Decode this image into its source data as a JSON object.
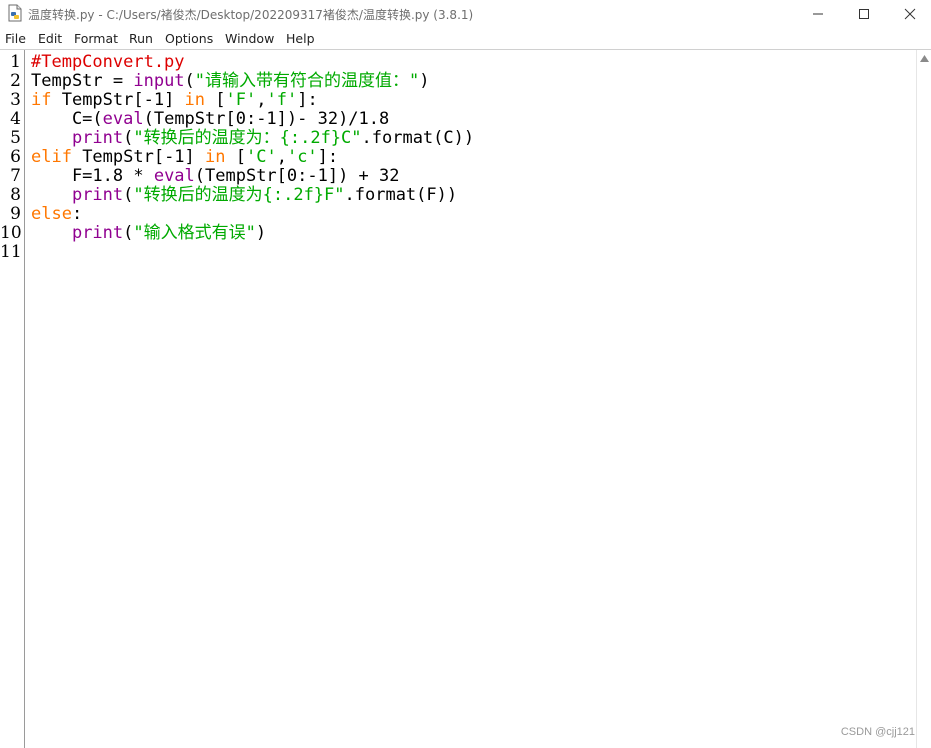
{
  "window": {
    "title_prefix": "温度转换.py - ",
    "title_path": "C:/Users/褚俊杰/Desktop/202209317褚俊杰/温度转换.py",
    "title_version": " (3.8.1)",
    "controls": [
      "minimize-icon",
      "maximize-icon",
      "close-icon"
    ]
  },
  "menu": [
    "File",
    "Edit",
    "Format",
    "Run",
    "Options",
    "Window",
    "Help"
  ],
  "colors": {
    "comment": "#dd0000",
    "keyword": "#ff7700",
    "builtin": "#900090",
    "string": "#00aa00",
    "default": "#000000"
  },
  "line_numbers": [
    "1",
    "2",
    "3",
    "4",
    "5",
    "6",
    "7",
    "8",
    "9",
    "10",
    "11"
  ],
  "code": [
    [
      {
        "t": "#TempConvert.py",
        "c": "comment"
      }
    ],
    [
      {
        "t": "TempStr = ",
        "c": "default"
      },
      {
        "t": "input",
        "c": "builtin"
      },
      {
        "t": "(",
        "c": "default"
      },
      {
        "t": "\"请输入带有符合的温度值：\"",
        "c": "string"
      },
      {
        "t": ")",
        "c": "default"
      }
    ],
    [
      {
        "t": "if",
        "c": "keyword"
      },
      {
        "t": " TempStr[-1] ",
        "c": "default"
      },
      {
        "t": "in",
        "c": "keyword"
      },
      {
        "t": " [",
        "c": "default"
      },
      {
        "t": "'F'",
        "c": "string"
      },
      {
        "t": ",",
        "c": "default"
      },
      {
        "t": "'f'",
        "c": "string"
      },
      {
        "t": "]:",
        "c": "default"
      }
    ],
    [
      {
        "t": "    C=(",
        "c": "default"
      },
      {
        "t": "eval",
        "c": "builtin"
      },
      {
        "t": "(TempStr[0:-1])- 32)/1.8",
        "c": "default"
      }
    ],
    [
      {
        "t": "    ",
        "c": "default"
      },
      {
        "t": "print",
        "c": "builtin"
      },
      {
        "t": "(",
        "c": "default"
      },
      {
        "t": "\"转换后的温度为：{:.2f}C\"",
        "c": "string"
      },
      {
        "t": ".format(C))",
        "c": "default"
      }
    ],
    [
      {
        "t": "elif",
        "c": "keyword"
      },
      {
        "t": " TempStr[-1] ",
        "c": "default"
      },
      {
        "t": "in",
        "c": "keyword"
      },
      {
        "t": " [",
        "c": "default"
      },
      {
        "t": "'C'",
        "c": "string"
      },
      {
        "t": ",",
        "c": "default"
      },
      {
        "t": "'c'",
        "c": "string"
      },
      {
        "t": "]:",
        "c": "default"
      }
    ],
    [
      {
        "t": "    F=1.8 * ",
        "c": "default"
      },
      {
        "t": "eval",
        "c": "builtin"
      },
      {
        "t": "(TempStr[0:-1]) + 32",
        "c": "default"
      }
    ],
    [
      {
        "t": "    ",
        "c": "default"
      },
      {
        "t": "print",
        "c": "builtin"
      },
      {
        "t": "(",
        "c": "default"
      },
      {
        "t": "\"转换后的温度为{:.2f}F\"",
        "c": "string"
      },
      {
        "t": ".format(F))",
        "c": "default"
      }
    ],
    [
      {
        "t": "else",
        "c": "keyword"
      },
      {
        "t": ":",
        "c": "default"
      }
    ],
    [
      {
        "t": "    ",
        "c": "default"
      },
      {
        "t": "print",
        "c": "builtin"
      },
      {
        "t": "(",
        "c": "default"
      },
      {
        "t": "\"输入格式有误\"",
        "c": "string"
      },
      {
        "t": ")",
        "c": "default"
      }
    ],
    []
  ],
  "watermark": "CSDN @cjj121"
}
